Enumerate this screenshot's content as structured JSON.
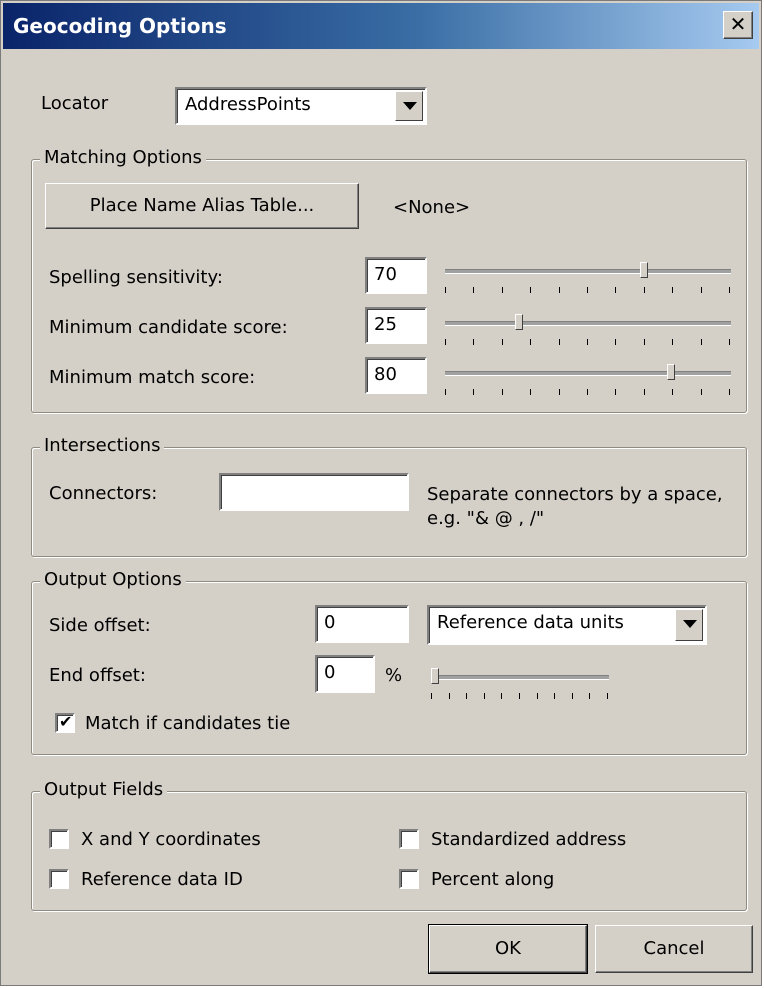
{
  "window": {
    "title": "Geocoding Options",
    "close_glyph": "✕"
  },
  "locator": {
    "label": "Locator",
    "value": "AddressPoints"
  },
  "matching": {
    "group_title": "Matching Options",
    "alias_button": "Place Name Alias Table...",
    "alias_value": "<None>",
    "spelling": {
      "label": "Spelling sensitivity:",
      "value": "70",
      "level": 70
    },
    "candidate": {
      "label": "Minimum candidate score:",
      "value": "25",
      "level": 25
    },
    "match": {
      "label": "Minimum match score:",
      "value": "80",
      "level": 80
    }
  },
  "intersections": {
    "group_title": "Intersections",
    "connectors_label": "Connectors:",
    "connectors_value": "",
    "hint": "Separate connectors by a space, e.g. \"& @ , /\""
  },
  "output_options": {
    "group_title": "Output Options",
    "side_offset_label": "Side offset:",
    "side_offset_value": "0",
    "units_value": "Reference data units",
    "end_offset_label": "End offset:",
    "end_offset_value": "0",
    "percent_label": "%",
    "end_offset_level": 0,
    "tie_label": "Match if candidates tie",
    "tie_checked": true
  },
  "output_fields": {
    "group_title": "Output Fields",
    "xy_label": "X and Y coordinates",
    "ref_id_label": "Reference data ID",
    "std_addr_label": "Standardized address",
    "pct_along_label": "Percent along",
    "xy_checked": false,
    "ref_id_checked": false,
    "std_addr_checked": false,
    "pct_along_checked": false
  },
  "buttons": {
    "ok": "OK",
    "cancel": "Cancel"
  }
}
